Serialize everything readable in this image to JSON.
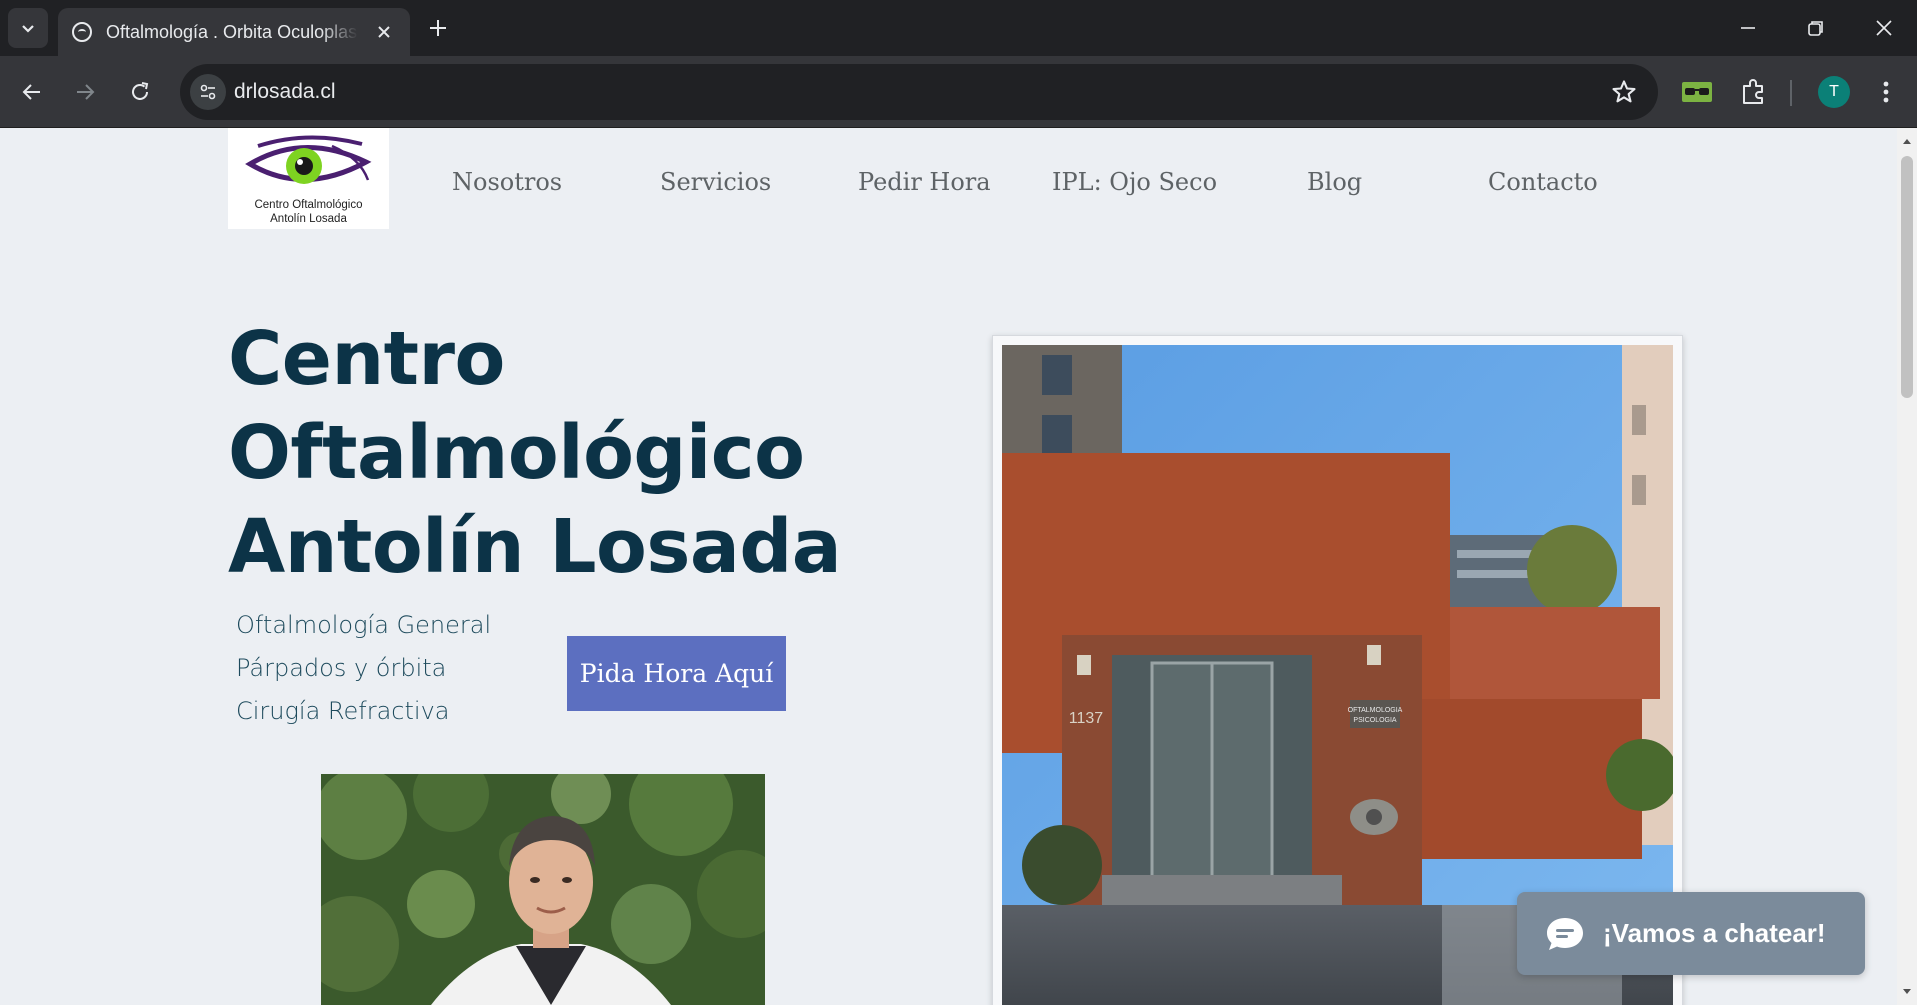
{
  "browser": {
    "tab_title": "Oftalmología . Orbita Oculoplastica",
    "url": "drlosada.cl",
    "profile_initial": "T",
    "icons": [
      "tab-search-icon",
      "close-icon",
      "plus-icon",
      "minimize-icon",
      "restore-icon",
      "close-window-icon",
      "back-icon",
      "forward-icon",
      "reload-icon",
      "site-info-icon",
      "star-icon",
      "glasses-extension-icon",
      "puzzle-icon",
      "more-vert-icon"
    ]
  },
  "site": {
    "logo": {
      "line1": "Centro Oftalmológico",
      "line2": "Antolín Losada"
    },
    "nav": [
      "Nosotros",
      "Servicios",
      "Pedir Hora",
      "IPL: Ojo Seco",
      "Blog",
      "Contacto"
    ],
    "hero": {
      "title_lines": [
        "Centro",
        "Oftalmológico",
        "Antolín Losada"
      ],
      "services": [
        "Oftalmología General",
        "Párpados y órbita",
        "Cirugía Refractiva"
      ],
      "cta": "Pida Hora Aquí"
    },
    "building_sign": {
      "line1": "OFTALMOLOGIA",
      "line2": "PSICOLOGIA",
      "number": "1137"
    },
    "chat": {
      "label": "¡Vamos a chatear!"
    }
  },
  "colors": {
    "title": "#0c3347",
    "nav": "#5e6366",
    "cta_bg": "#5c6fc0",
    "page_bg": "#eceff3",
    "chat_bg": "#7b8b9b"
  }
}
